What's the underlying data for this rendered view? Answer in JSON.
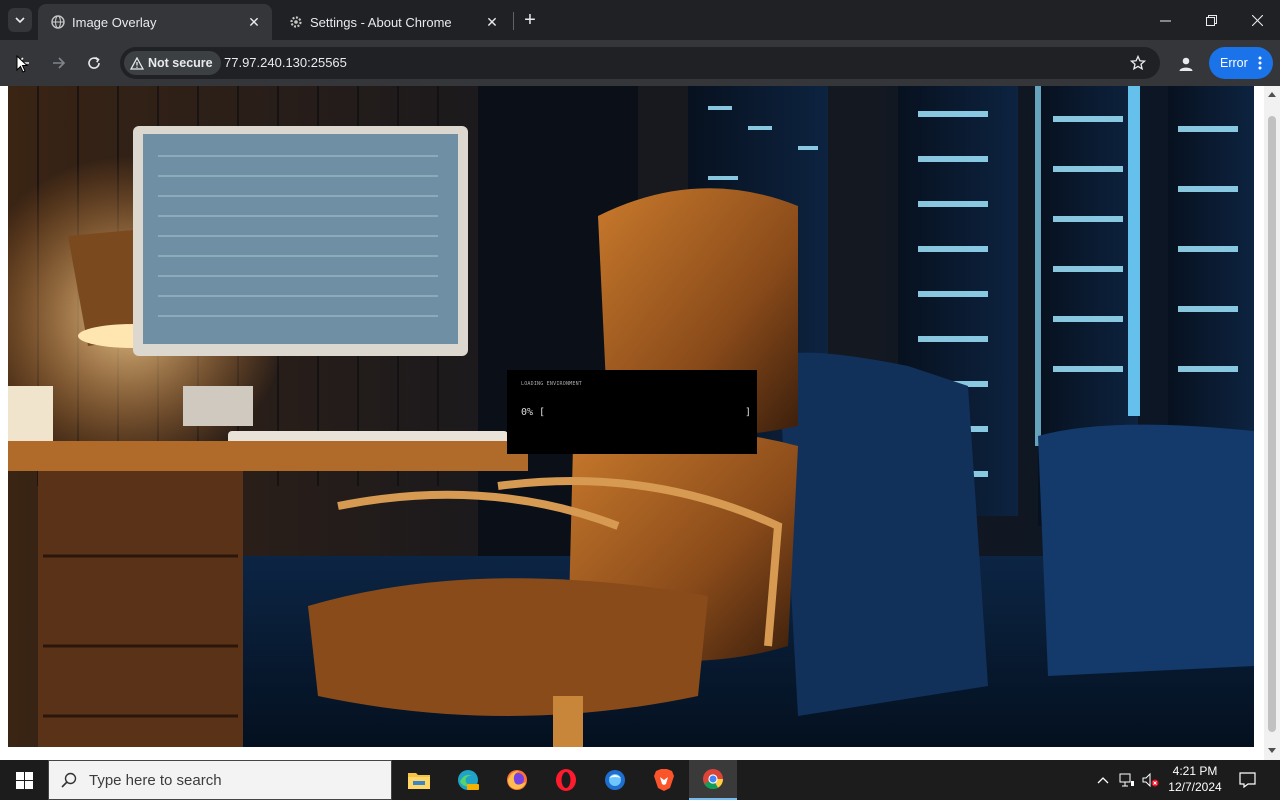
{
  "browser": {
    "tabs": [
      {
        "title": "Image Overlay",
        "active": true
      },
      {
        "title": "Settings - About Chrome",
        "active": false
      }
    ],
    "security_label": "Not secure",
    "url": "77.97.240.130:25565",
    "error_button_label": "Error"
  },
  "overlay": {
    "small_caption": "LOADING ENVIRONMENT",
    "progress_text": "0% [",
    "progress_end": "]",
    "progress_value": 0
  },
  "taskbar": {
    "search_placeholder": "Type here to search",
    "time": "4:21 PM",
    "date": "12/7/2024",
    "apps": [
      "file-explorer",
      "edge-canary",
      "firefox",
      "opera",
      "waterfox",
      "brave",
      "chrome"
    ]
  },
  "colors": {
    "accent": "#1a73e8",
    "tab_active": "#35363a",
    "titlebar": "#202124"
  }
}
